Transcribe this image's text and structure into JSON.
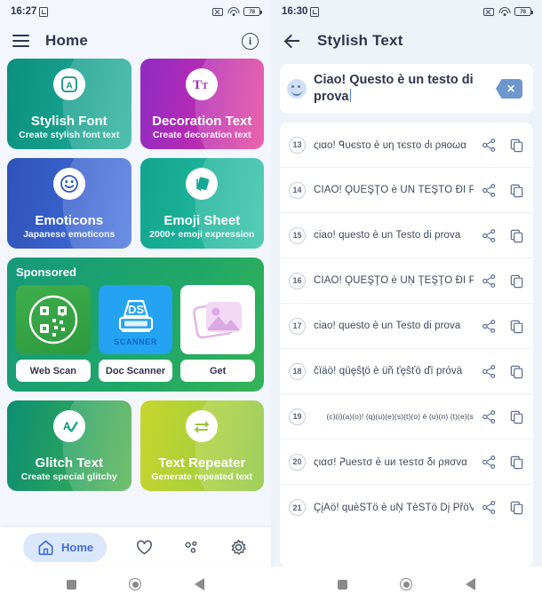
{
  "left_phone": {
    "status": {
      "time": "16:27",
      "battery": "78"
    },
    "appbar": {
      "title": "Home",
      "menu_icon": "hamburger-icon",
      "info_icon": "info-icon"
    },
    "cards": [
      {
        "title": "Stylish Font",
        "subtitle": "Create stylish font text",
        "icon": "letter-a-icon"
      },
      {
        "title": "Decoration Text",
        "subtitle": "Create decoration text",
        "icon": "tt-icon"
      },
      {
        "title": "Emoticons",
        "subtitle": "Japanese emoticons",
        "icon": "smiley-icon"
      },
      {
        "title": "Emoji Sheet",
        "subtitle": "2000+ emoji expression",
        "icon": "sheet-icon"
      },
      {
        "title": "Glitch Text",
        "subtitle": "Create special glitchy",
        "icon": "glitch-a-icon"
      },
      {
        "title": "Text Repeater",
        "subtitle": "Generate repeated text",
        "icon": "repeat-icon"
      }
    ],
    "sponsored": {
      "title": "Sponsored",
      "items": [
        {
          "label": "Web Scan",
          "icon": "qr-code-icon"
        },
        {
          "label": "Doc Scanner",
          "icon": "scanner-icon",
          "badge": "DS",
          "caption": "SCANNER"
        },
        {
          "label": "Get",
          "icon": "photo-icon"
        }
      ]
    },
    "bottom_nav": [
      {
        "label": "Home",
        "icon": "home-icon",
        "active": true
      },
      {
        "label": "",
        "icon": "heart-icon",
        "active": false
      },
      {
        "label": "",
        "icon": "share-nodes-icon",
        "active": false
      },
      {
        "label": "",
        "icon": "gear-icon",
        "active": false
      }
    ]
  },
  "right_phone": {
    "status": {
      "time": "16:30",
      "battery": "78"
    },
    "appbar": {
      "title": "Stylish Text",
      "back_icon": "back-arrow-icon"
    },
    "input": {
      "value": "Ciao! Questo è un testo di prova",
      "emoji_icon": "emoji-icon",
      "clear_icon": "backspace-icon"
    },
    "results": [
      {
        "num": "13",
        "text": "ςιαο! ᑫυєsτο è υη τєsτο ძι ρяοωα"
      },
      {
        "num": "14",
        "text": "ČĬÄÖ! ǪÛĒŞŢŌ è ÚŃ ŤĔŞŤŌ ĐĪ PŘÖVÄ"
      },
      {
        "num": "15",
        "text": "ciao! questo è un Testo di prova"
      },
      {
        "num": "16",
        "text": "ČĬÄÖ! ǪÛĒŞŢŌ è ÛŅ ŢĔŞŢŌ ĐĪ PŘŎVÄ"
      },
      {
        "num": "17",
        "text": "ciao! questo è un Testo di prova"
      },
      {
        "num": "18",
        "text": "čïäö! qüęŝţö è üñ ťęŝťö ďï próvä"
      },
      {
        "num": "19",
        "text": "(c)(i)(a)(o)! (q)(u)(e)(s)(t)(o) è (u)(n) (t)(e)(s"
      },
      {
        "num": "20",
        "text": "ςιασ! ᕈuesτσ è uи τesτσ δι ρяσvα"
      },
      {
        "num": "21",
        "text": "ÇįAö! quèŠŤö è uŅ ŤèŠŤö Ďį PřöVĄ"
      }
    ],
    "row_actions": {
      "share_icon": "share-icon",
      "copy_icon": "copy-icon"
    }
  },
  "android_nav": {
    "recents_icon": "square-recents-icon",
    "home_icon": "circle-home-icon",
    "back_icon": "triangle-back-icon"
  }
}
